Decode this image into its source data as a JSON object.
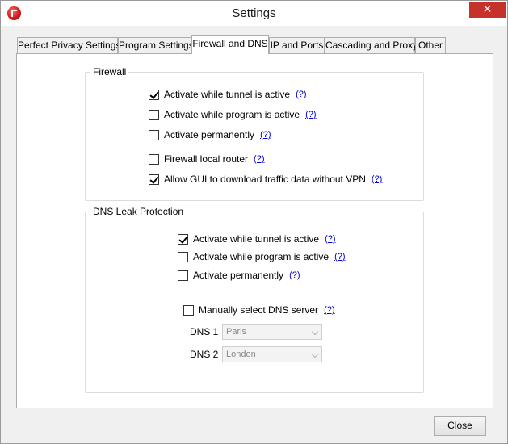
{
  "window": {
    "title": "Settings",
    "close_glyph": "✕",
    "app_icon": "perfect-privacy-logo-icon",
    "colors": {
      "close_button": "#c7312c",
      "help_link": "#0000cc"
    }
  },
  "tabs": [
    {
      "label": "Perfect Privacy Settings",
      "active": false
    },
    {
      "label": "Program Settings",
      "active": false
    },
    {
      "label": "Firewall and DNS",
      "active": true
    },
    {
      "label": "IP and Ports",
      "active": false
    },
    {
      "label": "Cascading and Proxy",
      "active": false
    },
    {
      "label": "Other",
      "active": false
    }
  ],
  "firewall": {
    "legend": "Firewall",
    "options": [
      {
        "label": "Activate while tunnel is active",
        "checked": true,
        "help": "(?)"
      },
      {
        "label": "Activate while program is active",
        "checked": false,
        "help": "(?)"
      },
      {
        "label": "Activate permanently",
        "checked": false,
        "help": "(?)"
      },
      {
        "label": "Firewall local router",
        "checked": false,
        "help": "(?)"
      },
      {
        "label": "Allow GUI to download traffic data without VPN",
        "checked": true,
        "help": "(?)"
      }
    ]
  },
  "dns": {
    "legend": "DNS Leak Protection",
    "options": [
      {
        "label": "Activate while tunnel is active",
        "checked": true,
        "help": "(?)"
      },
      {
        "label": "Activate while program is active",
        "checked": false,
        "help": "(?)"
      },
      {
        "label": "Activate permanently",
        "checked": false,
        "help": "(?)"
      }
    ],
    "manual": {
      "label": "Manually select DNS server",
      "checked": false,
      "help": "(?)"
    },
    "dns1": {
      "label": "DNS 1",
      "value": "Paris"
    },
    "dns2": {
      "label": "DNS 2",
      "value": "London"
    }
  },
  "footer": {
    "close_label": "Close"
  }
}
